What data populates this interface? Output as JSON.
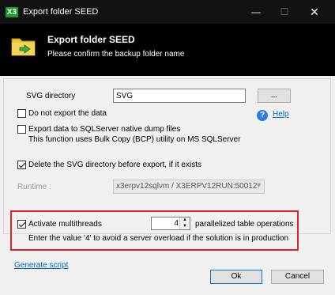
{
  "window": {
    "app_icon": "X3",
    "title": "Export folder SEED",
    "minimize_icon": "minimize-icon",
    "maximize_icon": "maximize-icon",
    "close_icon": "close-icon"
  },
  "header": {
    "icon": "folder-export-icon",
    "title": "Export folder SEED",
    "subtitle": "Please confirm the backup folder name"
  },
  "form": {
    "svg_directory_label": "SVG directory",
    "svg_directory_value": "SVG",
    "browse_label": "...",
    "no_export_label": "Do not export the data",
    "no_export_checked": false,
    "help_label": "Help",
    "sqlserver_label": "Export data to SQLServer native dump files",
    "sqlserver_sub": "This function uses Bulk Copy (BCP) utility on MS SQLServer",
    "sqlserver_checked": false,
    "delete_svg_label": "Delete the SVG directory before export, if it exists",
    "delete_svg_checked": true,
    "runtime_label": "Runtime :",
    "runtime_value": "x3erpv12sqlvm / X3ERPV12RUN:50012",
    "multithread_label": "Activate multithreads",
    "multithread_checked": true,
    "threads_value": "4",
    "threads_suffix": "parallelized table operations",
    "threads_hint": "Enter the value '4' to avoid a server overload if the solution is in production"
  },
  "footer": {
    "generate_script": "Generate script",
    "ok_label": "Ok",
    "cancel_label": "Cancel"
  },
  "colors": {
    "highlight_box": "#dd2222",
    "link": "#0066cc",
    "help_icon": "#2a7de1"
  }
}
